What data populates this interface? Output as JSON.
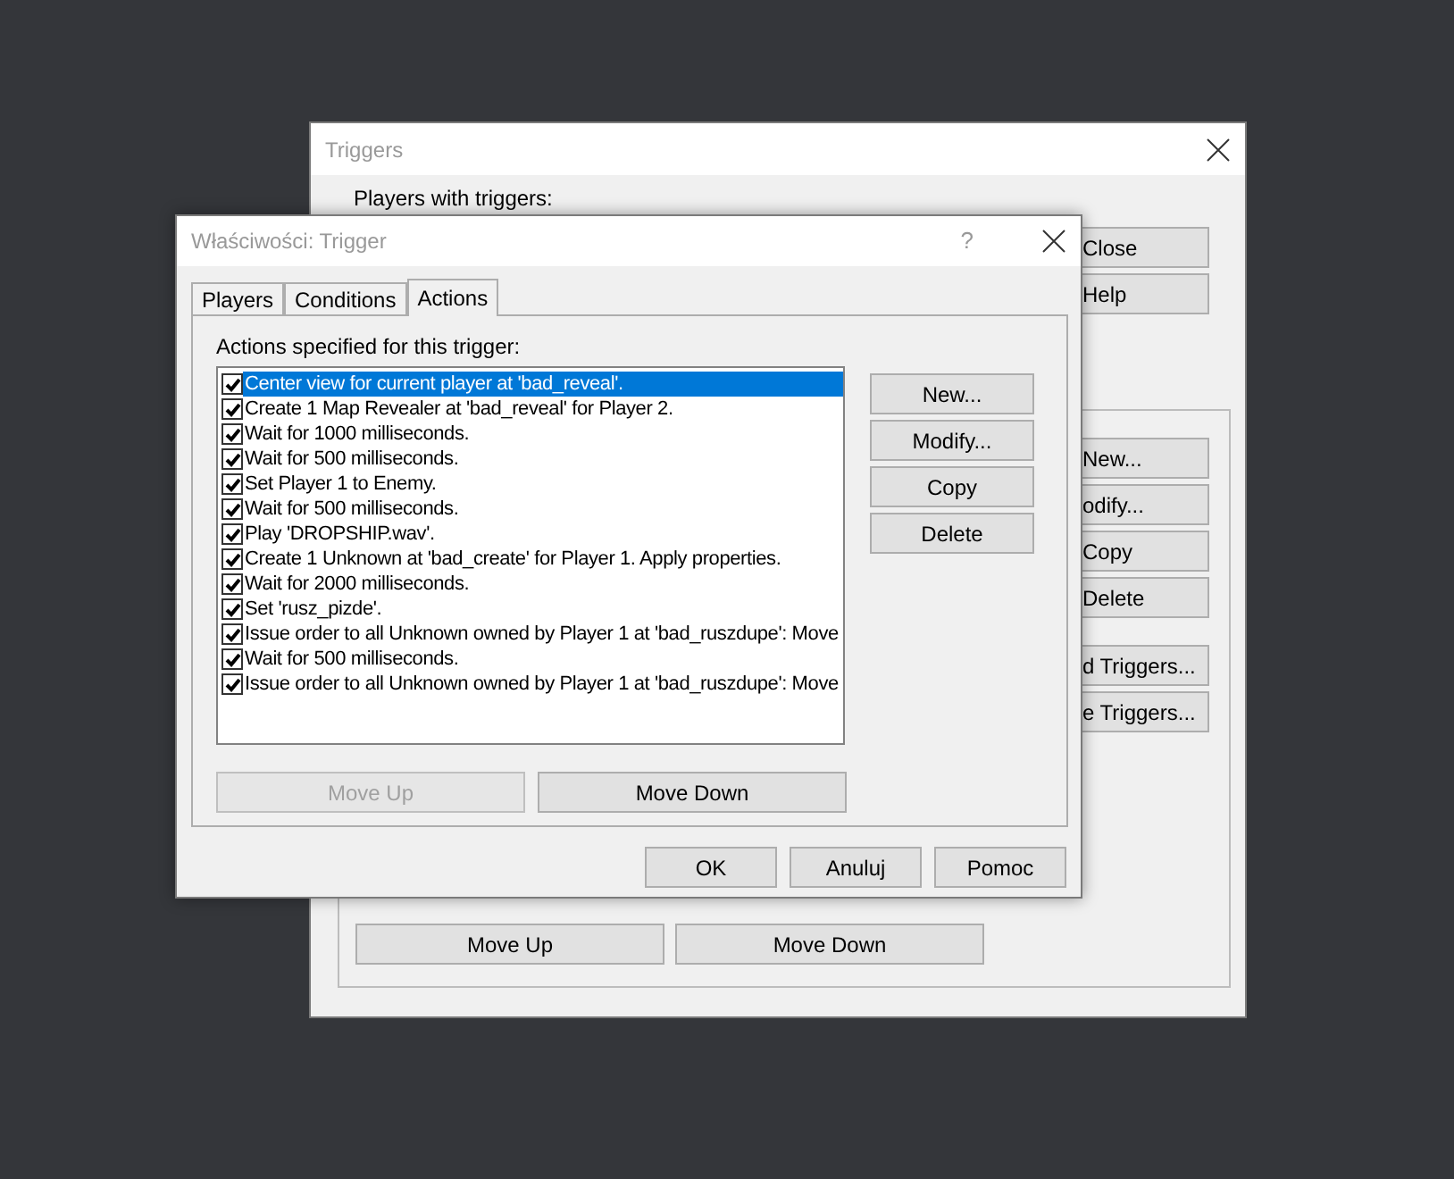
{
  "back_window": {
    "title": "Triggers",
    "players_label": "Players with triggers:",
    "top_buttons": [
      "Close",
      "Help"
    ],
    "side_buttons": [
      "New...",
      "odify...",
      "Copy",
      "Delete",
      "d Triggers...",
      "e Triggers..."
    ],
    "bottom_buttons": [
      "Move Up",
      "Move Down"
    ]
  },
  "dialog": {
    "title": "Właściwości: Trigger",
    "help_glyph": "?",
    "tabs": [
      {
        "label": "Players",
        "selected": false
      },
      {
        "label": "Conditions",
        "selected": false
      },
      {
        "label": "Actions",
        "selected": true
      }
    ],
    "list_label": "Actions specified for this trigger:",
    "actions": [
      {
        "text": "Center view for current player at 'bad_reveal'.",
        "checked": true,
        "selected": true
      },
      {
        "text": "Create 1 Map Revealer at 'bad_reveal' for Player 2.",
        "checked": true,
        "selected": false
      },
      {
        "text": "Wait for 1000 milliseconds.",
        "checked": true,
        "selected": false
      },
      {
        "text": "Wait for 500 milliseconds.",
        "checked": true,
        "selected": false
      },
      {
        "text": "Set Player 1 to Enemy.",
        "checked": true,
        "selected": false
      },
      {
        "text": "Wait for 500 milliseconds.",
        "checked": true,
        "selected": false
      },
      {
        "text": "Play 'DROPSHIP.wav'.",
        "checked": true,
        "selected": false
      },
      {
        "text": "Create 1 Unknown at 'bad_create' for Player 1. Apply properties.",
        "checked": true,
        "selected": false
      },
      {
        "text": "Wait for 2000 milliseconds.",
        "checked": true,
        "selected": false
      },
      {
        "text": "Set 'rusz_pizde'.",
        "checked": true,
        "selected": false
      },
      {
        "text": "Issue order to all Unknown owned by Player 1 at 'bad_ruszdupe': Move",
        "checked": true,
        "selected": false
      },
      {
        "text": "Wait for 500 milliseconds.",
        "checked": true,
        "selected": false
      },
      {
        "text": "Issue order to all Unknown owned by Player 1 at 'bad_ruszdupe': Move",
        "checked": true,
        "selected": false
      }
    ],
    "side_buttons": [
      "New...",
      "Modify...",
      "Copy",
      "Delete"
    ],
    "move_buttons": [
      {
        "label": "Move Up",
        "disabled": true
      },
      {
        "label": "Move Down",
        "disabled": false
      }
    ],
    "footer_buttons": [
      "OK",
      "Anuluj",
      "Pomoc"
    ]
  }
}
